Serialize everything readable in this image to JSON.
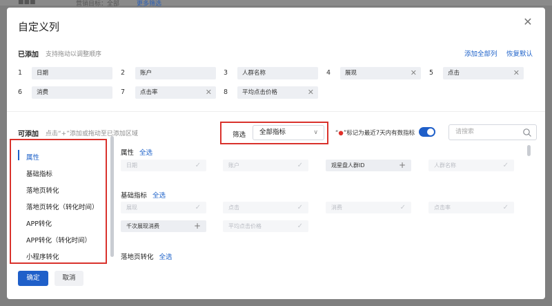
{
  "background": {
    "frag_left": "■■■",
    "frag_mid": "营销目标：全部",
    "frag_link": "更多筛选"
  },
  "dialog": {
    "title": "自定义列",
    "added": {
      "label": "已添加",
      "hint": "支持拖动以调整顺序",
      "add_all": "添加全部列",
      "restore": "恢复默认",
      "items": [
        {
          "num": "1",
          "label": "日期"
        },
        {
          "num": "2",
          "label": "账户"
        },
        {
          "num": "3",
          "label": "人群名称"
        },
        {
          "num": "4",
          "label": "展现"
        },
        {
          "num": "5",
          "label": "点击"
        },
        {
          "num": "6",
          "label": "消费"
        },
        {
          "num": "7",
          "label": "点击率"
        },
        {
          "num": "8",
          "label": "平均点击价格"
        }
      ]
    },
    "available": {
      "label": "可添加",
      "hint": "点击“+”添加或拖动至已添加区域",
      "filter_label": "筛选",
      "filter_value": "全部指标",
      "marker_note": "“●”标记为最近7天内有数指标",
      "search_placeholder": "请搜索",
      "select_all": "全选",
      "categories": [
        "属性",
        "基础指标",
        "落地页转化",
        "落地页转化（转化时间）",
        "APP转化",
        "APP转化（转化时间）",
        "小程序转化"
      ],
      "groups": {
        "attr": {
          "title": "属性",
          "items": [
            "日期",
            "账户",
            "观星盘人群ID",
            "人群名称"
          ]
        },
        "basic": {
          "title": "基础指标",
          "items": [
            "展现",
            "点击",
            "消费",
            "点击率",
            "千次展现消费",
            "平均点击价格"
          ]
        },
        "landing": {
          "title": "落地页转化"
        }
      }
    },
    "ok_label": "确定",
    "cancel_label": "取消"
  },
  "colors": {
    "accent": "#1f5fc9",
    "highlight": "#d9312b",
    "marker": "#e0302a"
  }
}
